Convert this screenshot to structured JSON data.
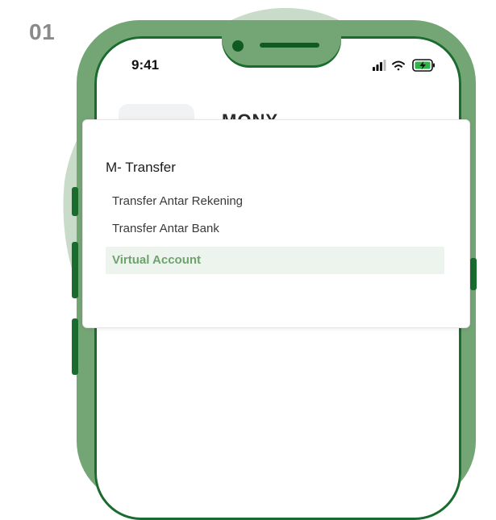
{
  "step_number": "01",
  "status_bar": {
    "time": "9:41",
    "icons": [
      "signal-icon",
      "wifi-icon",
      "battery-charging-icon"
    ]
  },
  "app": {
    "title_partial": "MONY"
  },
  "menu": {
    "title": "M- Transfer",
    "items": [
      {
        "label": "Transfer Antar Rekening",
        "selected": false
      },
      {
        "label": "Transfer Antar Bank",
        "selected": false
      },
      {
        "label": "Virtual Account",
        "selected": true
      }
    ]
  },
  "colors": {
    "phone_frame": "#74a574",
    "phone_outline": "#1a6b2e",
    "background_blob": "#c9dcc9",
    "selected_item_bg": "#edf3ed",
    "selected_item_text": "#6ea36e"
  }
}
